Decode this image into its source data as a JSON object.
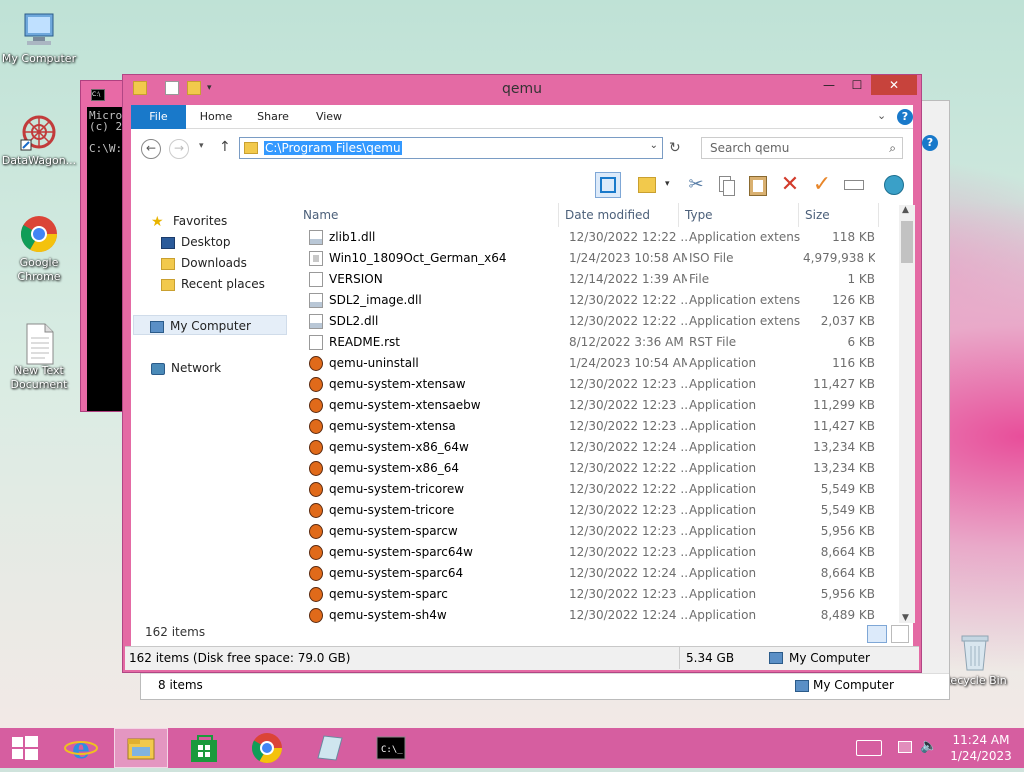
{
  "desktop": {
    "icons": [
      {
        "label": "My Computer"
      },
      {
        "label": "DataWagon..."
      },
      {
        "label": "Google Chrome"
      },
      {
        "label": "New Text Document"
      },
      {
        "label": "Recycle Bin"
      }
    ]
  },
  "cmd": {
    "text": "Micro\n(c) 2\n\nC:\\W:"
  },
  "back_window": {
    "status_left": "8 items",
    "status_right": "My Computer"
  },
  "window": {
    "title": "qemu",
    "ribbon_tabs": [
      "File",
      "Home",
      "Share",
      "View"
    ],
    "address": "C:\\Program Files\\qemu",
    "search_placeholder": "Search qemu",
    "nav": {
      "favorites": "Favorites",
      "desktop": "Desktop",
      "downloads": "Downloads",
      "recent": "Recent places",
      "computer": "My Computer",
      "network": "Network"
    },
    "columns": {
      "name": "Name",
      "date": "Date modified",
      "type": "Type",
      "size": "Size"
    },
    "files": [
      {
        "name": "zlib1.dll",
        "date": "12/30/2022 12:22 ...",
        "type": "Application extens...",
        "size": "118 KB",
        "icon": "dll"
      },
      {
        "name": "Win10_1809Oct_German_x64",
        "date": "1/24/2023 10:58 AM",
        "type": "ISO File",
        "size": "4,979,938 KB",
        "icon": "iso"
      },
      {
        "name": "VERSION",
        "date": "12/14/2022 1:39 AM",
        "type": "File",
        "size": "1 KB",
        "icon": "file"
      },
      {
        "name": "SDL2_image.dll",
        "date": "12/30/2022 12:22 ...",
        "type": "Application extens...",
        "size": "126 KB",
        "icon": "dll"
      },
      {
        "name": "SDL2.dll",
        "date": "12/30/2022 12:22 ...",
        "type": "Application extens...",
        "size": "2,037 KB",
        "icon": "dll"
      },
      {
        "name": "README.rst",
        "date": "8/12/2022 3:36 AM",
        "type": "RST File",
        "size": "6 KB",
        "icon": "file"
      },
      {
        "name": "qemu-uninstall",
        "date": "1/24/2023 10:54 AM",
        "type": "Application",
        "size": "116 KB",
        "icon": "app"
      },
      {
        "name": "qemu-system-xtensaw",
        "date": "12/30/2022 12:23 ...",
        "type": "Application",
        "size": "11,427 KB",
        "icon": "app"
      },
      {
        "name": "qemu-system-xtensaebw",
        "date": "12/30/2022 12:23 ...",
        "type": "Application",
        "size": "11,299 KB",
        "icon": "app"
      },
      {
        "name": "qemu-system-xtensa",
        "date": "12/30/2022 12:23 ...",
        "type": "Application",
        "size": "11,427 KB",
        "icon": "app"
      },
      {
        "name": "qemu-system-x86_64w",
        "date": "12/30/2022 12:24 ...",
        "type": "Application",
        "size": "13,234 KB",
        "icon": "app"
      },
      {
        "name": "qemu-system-x86_64",
        "date": "12/30/2022 12:22 ...",
        "type": "Application",
        "size": "13,234 KB",
        "icon": "app"
      },
      {
        "name": "qemu-system-tricorew",
        "date": "12/30/2022 12:22 ...",
        "type": "Application",
        "size": "5,549 KB",
        "icon": "app"
      },
      {
        "name": "qemu-system-tricore",
        "date": "12/30/2022 12:23 ...",
        "type": "Application",
        "size": "5,549 KB",
        "icon": "app"
      },
      {
        "name": "qemu-system-sparcw",
        "date": "12/30/2022 12:23 ...",
        "type": "Application",
        "size": "5,956 KB",
        "icon": "app"
      },
      {
        "name": "qemu-system-sparc64w",
        "date": "12/30/2022 12:23 ...",
        "type": "Application",
        "size": "8,664 KB",
        "icon": "app"
      },
      {
        "name": "qemu-system-sparc64",
        "date": "12/30/2022 12:24 ...",
        "type": "Application",
        "size": "8,664 KB",
        "icon": "app"
      },
      {
        "name": "qemu-system-sparc",
        "date": "12/30/2022 12:23 ...",
        "type": "Application",
        "size": "5,956 KB",
        "icon": "app"
      },
      {
        "name": "qemu-system-sh4w",
        "date": "12/30/2022 12:24 ...",
        "type": "Application",
        "size": "8,489 KB",
        "icon": "app"
      }
    ],
    "item_count": "162 items",
    "status_left": "162 items (Disk free space: 79.0 GB)",
    "status_size": "5.34 GB",
    "status_location": "My Computer"
  },
  "taskbar": {
    "time": "11:24 AM",
    "date": "1/24/2023"
  },
  "colors": {
    "accent": "#1979ca",
    "window_frame": "#e46aa4",
    "taskbar": "#d65ea0"
  }
}
